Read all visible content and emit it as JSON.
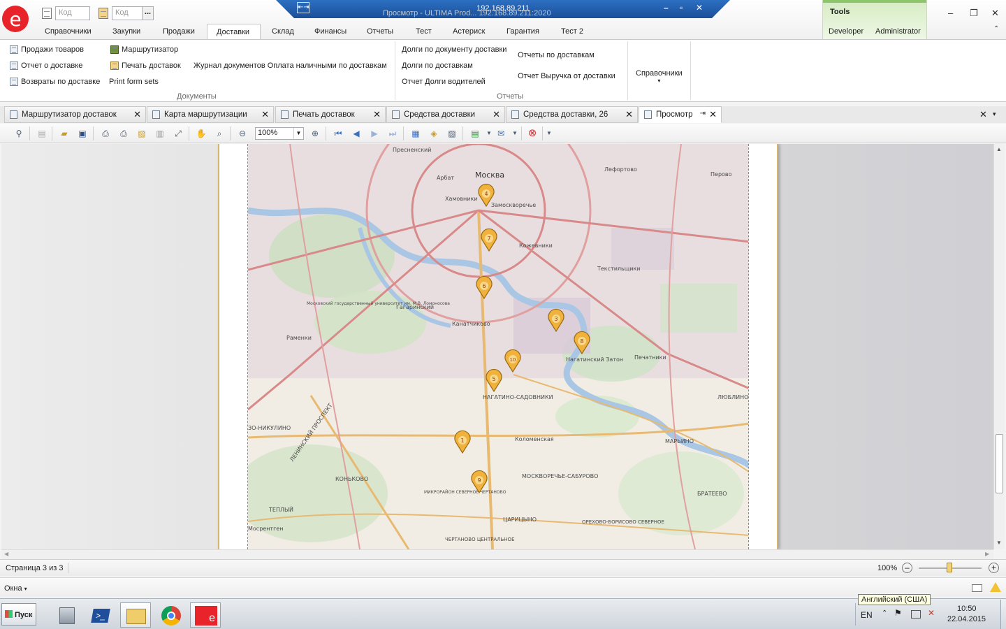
{
  "window": {
    "rdp_host": "192.168.89.211",
    "app_title_faded": "Просмотр - ULTIMA Prod... 192.168.89.211:2020"
  },
  "quick_access": {
    "code1_placeholder": "Код",
    "code2_placeholder": "Код",
    "more_label": "..."
  },
  "ribbon_tabs": [
    "Справочники",
    "Закупки",
    "Продажи",
    "Доставки",
    "Склад",
    "Финансы",
    "Отчеты",
    "Тест",
    "Астериск",
    "Гарантия",
    "Тест 2"
  ],
  "tools": {
    "label": "Tools",
    "developer": "Developer",
    "administrator": "Administrator"
  },
  "ribbon": {
    "documents_group": {
      "label": "Документы",
      "items": [
        "Продажи товаров",
        "Отчет о доставке",
        "Возвраты по доставке",
        "Маршрутизатор",
        "Печать доставок",
        "Print form sets",
        "Журнал документов Оплата наличными по доставкам"
      ]
    },
    "reports_group": {
      "label": "Отчеты",
      "items": [
        "Долги по документу доставки",
        "Долги по доставкам",
        "Отчет Долги водителей",
        "Отчеты по доставкам",
        "Отчет Выручка от доставки"
      ]
    },
    "refs_label": "Справочники",
    "refs_arrow": "▾"
  },
  "doc_tabs": [
    "Маршрутизатор доставок",
    "Карта маршрутизации",
    "Печать доставок",
    "Средства доставки",
    "Средства доставки, 26",
    "Просмотр"
  ],
  "viewer": {
    "zoom_value": "100%"
  },
  "map": {
    "labels": {
      "moscow": "Москва",
      "presnensky": "Пресненский",
      "arbat": "Арбат",
      "khamovniki": "Хамовники",
      "zamoskvorechye": "Замоскворечье",
      "kozhevniki": "Кожевники",
      "tekstilshchiki": "Текстильщики",
      "lefortovo": "Лефортово",
      "perovo": "Перово",
      "gagarinsky": "Гагаринский",
      "kanatchikovo": "Канатчиково",
      "ramenki": "Раменки",
      "nagatinsky": "Нагатинский Затон",
      "pechatniki": "Печатники",
      "nagatino": "НАГАТИНО-САДОВНИКИ",
      "kolomenskaya": "Коломенская",
      "lyublino": "ЛЮБЛИНО",
      "nikulino": "ЗО-НИКУЛИНО",
      "leninsky": "ЛЕНИНСКИЙ ПРОСПЕКТ",
      "konkovo": "КОНЬКОВО",
      "severnoe_chertanovo": "МИКРОРАЙОН СЕВЕРНОЕ ЧЕРТАНОВО",
      "moskvorechye": "МОСКВОРЕЧЬЕ-САБУРОВО",
      "maryino": "МАРЬИНО",
      "brateevo": "БРАТЕЕВО",
      "teply": "ТЕПЛЫЙ",
      "tsaritsyno": "ЦАРИЦЫНО",
      "orekhovo": "ОРЕХОВО-БОРИСОВО СЕВЕРНОЕ",
      "chertanovo_c": "ЧЕРТАНОВО ЦЕНТРАЛЬНОЕ",
      "mosrentgen": "Мосрентген",
      "msu": "Московский государственный университет им. М.В. Ломоносова"
    },
    "markers": [
      "4",
      "7",
      "6",
      "3",
      "8",
      "10",
      "5",
      "1",
      "9"
    ]
  },
  "status": {
    "page_info": "Страница 3 из 3",
    "zoom": "100%",
    "windows_label": "Окна"
  },
  "taskbar": {
    "start": "Пуск",
    "lang": "EN",
    "lang_tooltip": "Английский (США)",
    "time": "10:50",
    "date": "22.04.2015"
  }
}
